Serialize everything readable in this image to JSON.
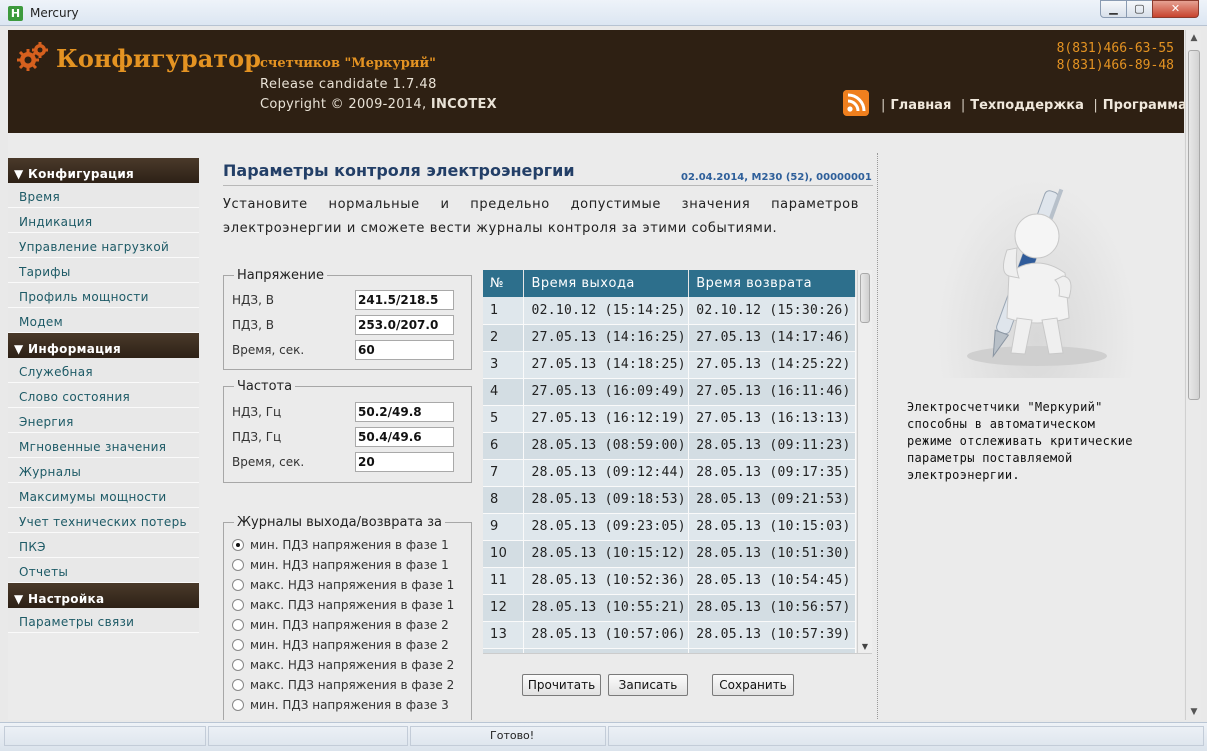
{
  "window": {
    "title": "Mercury",
    "icon_letter": "H"
  },
  "header": {
    "brand": "Конфигуратор",
    "brand_sub": "счетчиков \"Меркурий\"",
    "release": "Release candidate 1.7.48",
    "copyright_prefix": "Copyright © 2009-2014, ",
    "copyright_company": "INCOTEX",
    "phones": [
      "8(831)466-63-55",
      "8(831)466-89-48"
    ],
    "nav": [
      "Главная",
      "Техподдержка",
      "Программа"
    ]
  },
  "sidebar": {
    "sections": [
      {
        "title": "▼ Конфигурация",
        "items": [
          "Время",
          "Индикация",
          "Управление нагрузкой",
          "Тарифы",
          "Профиль мощности",
          "Модем"
        ]
      },
      {
        "title": "▼ Информация",
        "items": [
          "Служебная",
          "Слово состояния",
          "Энергия",
          "Мгновенные значения",
          "Журналы",
          "Максимумы мощности",
          "Учет технических потерь",
          "ПКЭ",
          "Отчеты"
        ]
      },
      {
        "title": "▼ Настройка",
        "items": [
          "Параметры связи"
        ]
      }
    ]
  },
  "main": {
    "title": "Параметры контроля электроэнергии",
    "meta": "02.04.2014, M230 (52), 00000001",
    "intro": "Установите нормальные и предельно допустимые значения параметров электроэнергии и сможете вести журналы контроля за этими событиями.",
    "voltage": {
      "legend": "Напряжение",
      "rows": [
        {
          "label": "НДЗ, В",
          "value": "241.5/218.5"
        },
        {
          "label": "ПДЗ, В",
          "value": "253.0/207.0"
        },
        {
          "label": "Время, сек.",
          "value": "60"
        }
      ]
    },
    "frequency": {
      "legend": "Частота",
      "rows": [
        {
          "label": "НДЗ, Гц",
          "value": "50.2/49.8"
        },
        {
          "label": "ПДЗ, Гц",
          "value": "50.4/49.6"
        },
        {
          "label": "Время, сек.",
          "value": "20"
        }
      ]
    },
    "journal": {
      "legend": "Журналы выхода/возврата за",
      "selected_index": 0,
      "options": [
        "мин. ПДЗ напряжения в фазе 1",
        "мин. НДЗ напряжения в фазе 1",
        "макс. НДЗ напряжения в фазе 1",
        "макс. ПДЗ напряжения в фазе 1",
        "мин. ПДЗ напряжения в фазе 2",
        "мин. НДЗ напряжения в фазе 2",
        "макс. НДЗ напряжения в фазе 2",
        "макс. ПДЗ напряжения в фазе 2",
        "мин. ПДЗ напряжения в фазе 3"
      ]
    },
    "table": {
      "columns": [
        "№",
        "Время выхода",
        "Время возврата"
      ],
      "rows": [
        [
          "1",
          "02.10.12 (15:14:25)",
          "02.10.12 (15:30:26)"
        ],
        [
          "2",
          "27.05.13 (14:16:25)",
          "27.05.13 (14:17:46)"
        ],
        [
          "3",
          "27.05.13 (14:18:25)",
          "27.05.13 (14:25:22)"
        ],
        [
          "4",
          "27.05.13 (16:09:49)",
          "27.05.13 (16:11:46)"
        ],
        [
          "5",
          "27.05.13 (16:12:19)",
          "27.05.13 (16:13:13)"
        ],
        [
          "6",
          "28.05.13 (08:59:00)",
          "28.05.13 (09:11:23)"
        ],
        [
          "7",
          "28.05.13 (09:12:44)",
          "28.05.13 (09:17:35)"
        ],
        [
          "8",
          "28.05.13 (09:18:53)",
          "28.05.13 (09:21:53)"
        ],
        [
          "9",
          "28.05.13 (09:23:05)",
          "28.05.13 (10:15:03)"
        ],
        [
          "10",
          "28.05.13 (10:15:12)",
          "28.05.13 (10:51:30)"
        ],
        [
          "11",
          "28.05.13 (10:52:36)",
          "28.05.13 (10:54:45)"
        ],
        [
          "12",
          "28.05.13 (10:55:21)",
          "28.05.13 (10:56:57)"
        ],
        [
          "13",
          "28.05.13 (10:57:06)",
          "28.05.13 (10:57:39)"
        ],
        [
          "14",
          "",
          ""
        ]
      ]
    },
    "buttons": {
      "read": "Прочитать",
      "write": "Записать",
      "save": "Сохранить"
    }
  },
  "promo": {
    "lines": [
      "Электросчетчики \"Меркурий\"",
      "способны в автоматическом",
      "режиме отслеживать критические",
      "параметры поставляемой",
      "электроэнергии."
    ]
  },
  "status": {
    "text": "Готово!"
  },
  "colors": {
    "accent": "#e49322",
    "header_bg": "#2e2013",
    "table_header": "#2d6f8c",
    "link": "#1d5a66",
    "title": "#233f67"
  },
  "icons": {
    "gear": "gear-icon",
    "rss": "rss-icon",
    "illustration": "pen-figure-illustration"
  }
}
